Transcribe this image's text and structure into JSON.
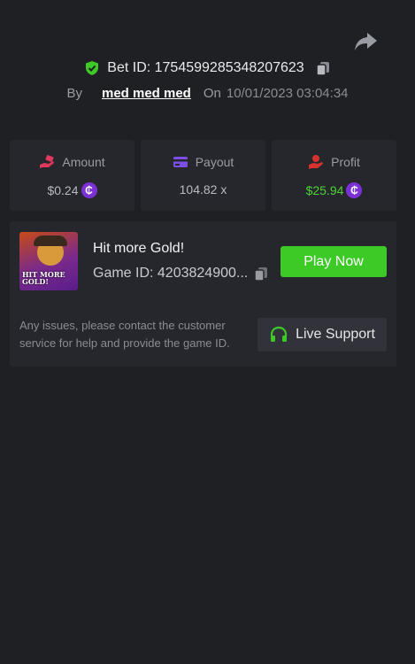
{
  "header": {
    "bet_id_label": "Bet ID: 1754599285348207623",
    "by_label": "By",
    "username": "med med med",
    "on_label": "On",
    "date": "10/01/2023 03:04:34"
  },
  "stats": [
    {
      "label": "Amount",
      "value": "$0.24",
      "icon": "money-hand-icon",
      "color": "#e0375d",
      "has_coin": true
    },
    {
      "label": "Payout",
      "value": "104.82 x",
      "icon": "card-icon",
      "color": "#7b4ee6",
      "has_coin": false
    },
    {
      "label": "Profit",
      "value": "$25.94",
      "icon": "profit-hand-icon",
      "color": "#d8322e",
      "has_coin": true,
      "value_color": "#4cd434"
    }
  ],
  "coin_symbol": "₵",
  "game": {
    "title": "Hit more Gold!",
    "id_label": "Game ID: 4203824900...",
    "thumbnail_text": "HIT MORE GOLD!",
    "play_label": "Play Now",
    "help_text": "Any issues, please contact the customer service for help and provide the game ID.",
    "support_label": "Live Support"
  },
  "colors": {
    "background": "#1f2024",
    "card": "#26272c",
    "accent_green": "#3dc926",
    "shield_green": "#3dc926",
    "coin_purple": "#7b31d6"
  }
}
